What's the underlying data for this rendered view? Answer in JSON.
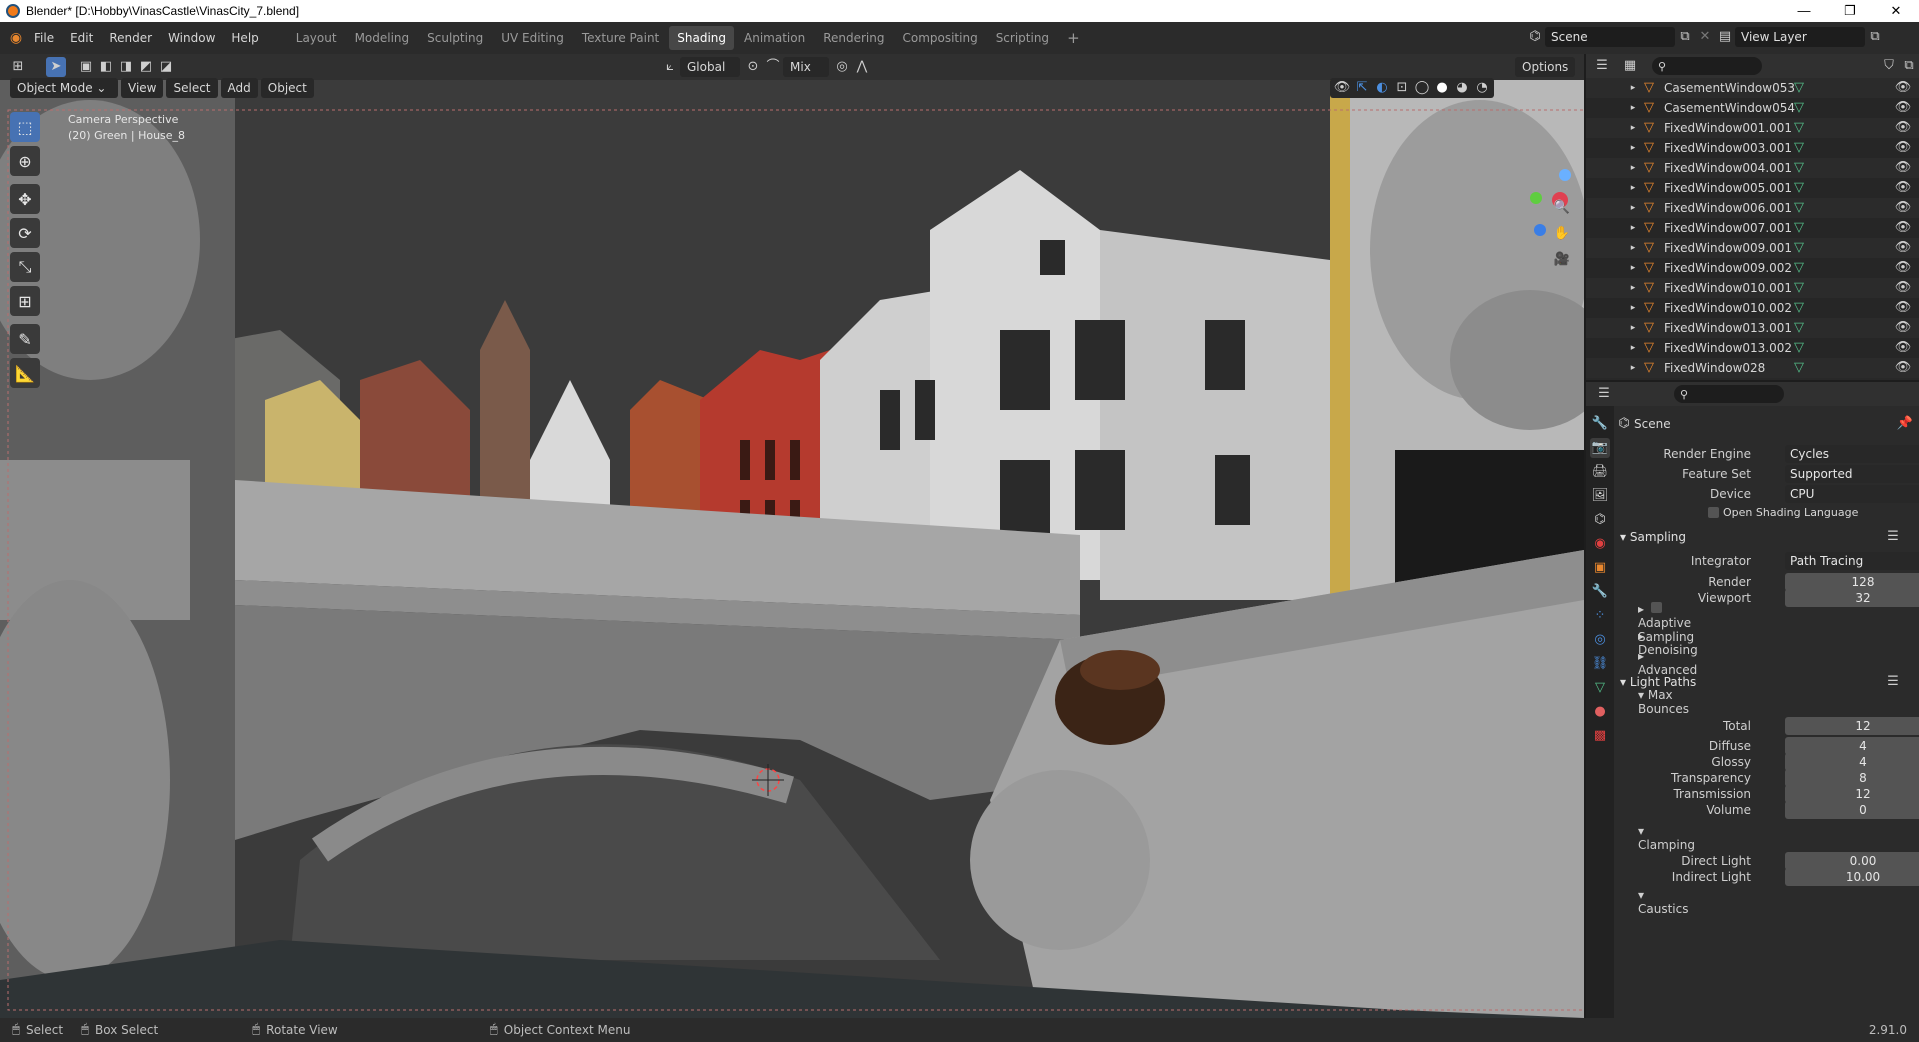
{
  "window": {
    "title": "Blender* [D:\\Hobby\\VinasCastle\\VinasCity_7.blend]",
    "controls": [
      "—",
      "❐",
      "✕"
    ]
  },
  "menu": [
    "File",
    "Edit",
    "Render",
    "Window",
    "Help"
  ],
  "workspaces": [
    {
      "label": "Layout"
    },
    {
      "label": "Modeling"
    },
    {
      "label": "Sculpting"
    },
    {
      "label": "UV Editing"
    },
    {
      "label": "Texture Paint"
    },
    {
      "label": "Shading",
      "active": true
    },
    {
      "label": "Animation"
    },
    {
      "label": "Rendering"
    },
    {
      "label": "Compositing"
    },
    {
      "label": "Scripting"
    }
  ],
  "add_workspace": "+",
  "scene": "Scene",
  "view_layer": "View Layer",
  "viewport_header": {
    "transform_orientation": "Global",
    "snap_mode": "Mix",
    "options": "Options",
    "mode": "Object Mode",
    "view": "View",
    "select": "Select",
    "add": "Add",
    "object": "Object"
  },
  "viewport_overlay": {
    "line1": "Camera Perspective",
    "line2": "(20) Green | House_8"
  },
  "outliner": {
    "items": [
      "CasementWindow053",
      "CasementWindow054",
      "FixedWindow001.001",
      "FixedWindow003.001",
      "FixedWindow004.001",
      "FixedWindow005.001",
      "FixedWindow006.001",
      "FixedWindow007.001",
      "FixedWindow009.001",
      "FixedWindow009.002",
      "FixedWindow010.001",
      "FixedWindow010.002",
      "FixedWindow013.001",
      "FixedWindow013.002",
      "FixedWindow028"
    ]
  },
  "properties": {
    "context": "Scene",
    "render_engine_label": "Render Engine",
    "render_engine": "Cycles",
    "feature_set_label": "Feature Set",
    "feature_set": "Supported",
    "device_label": "Device",
    "device": "CPU",
    "osl": "Open Shading Language",
    "sampling": "Sampling",
    "integrator_label": "Integrator",
    "integrator": "Path Tracing",
    "render_label": "Render",
    "render_samples": "128",
    "viewport_label": "Viewport",
    "viewport_samples": "32",
    "adaptive": "Adaptive Sampling",
    "denoising": "Denoising",
    "advanced": "Advanced",
    "light_paths": "Light Paths",
    "max_bounces": "Max Bounces",
    "total_label": "Total",
    "total": "12",
    "diffuse_label": "Diffuse",
    "diffuse": "4",
    "glossy_label": "Glossy",
    "glossy": "4",
    "transparency_label": "Transparency",
    "transparency": "8",
    "transmission_label": "Transmission",
    "transmission": "12",
    "volume_label": "Volume",
    "volume": "0",
    "clamping": "Clamping",
    "direct_label": "Direct Light",
    "direct": "0.00",
    "indirect_label": "Indirect Light",
    "indirect": "10.00",
    "caustics": "Caustics"
  },
  "status": {
    "select": "Select",
    "box_select": "Box Select",
    "rotate": "Rotate View",
    "context_menu": "Object Context Menu",
    "version": "2.91.0"
  },
  "colors": {
    "accent": "#4772b3",
    "active_tab": "#474747",
    "panel": "#2b2b2b",
    "viewport_sky": "#3a3a3a",
    "orange_icon": "#e8872e",
    "green_icon": "#54c08a"
  }
}
